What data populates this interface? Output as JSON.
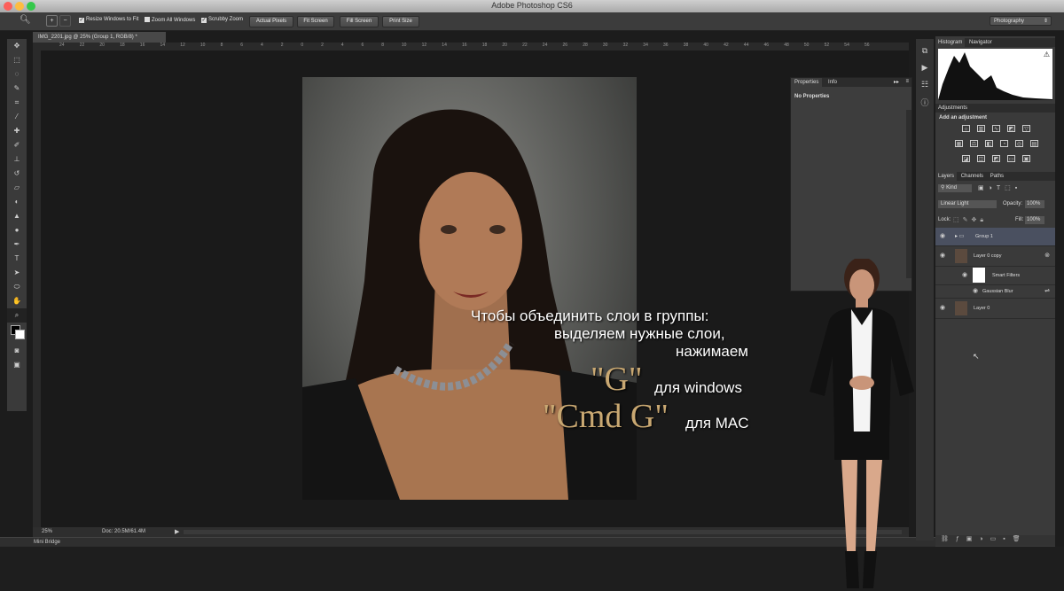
{
  "app": {
    "title": "Adobe Photoshop CS6"
  },
  "options_bar": {
    "checkboxes": [
      "Resize Windows to Fit",
      "Zoom All Windows",
      "Scrubby Zoom"
    ],
    "buttons": [
      "Actual Pixels",
      "Fit Screen",
      "Fill Screen",
      "Print Size"
    ],
    "workspace": "Photography"
  },
  "document": {
    "tab_title": "IMG_2201.jpg @ 25% (Group 1, RGB/8) *",
    "zoom": "25%",
    "doc_size": "Doc: 20.5M/61.4M",
    "ruler_ticks": [
      "24",
      "22",
      "20",
      "18",
      "16",
      "14",
      "12",
      "10",
      "8",
      "6",
      "4",
      "2",
      "0",
      "2",
      "4",
      "6",
      "8",
      "10",
      "12",
      "14",
      "16",
      "18",
      "20",
      "22",
      "24",
      "26",
      "28",
      "30",
      "32",
      "34",
      "36",
      "38",
      "40",
      "42",
      "44",
      "46",
      "48",
      "50",
      "52",
      "54",
      "56"
    ]
  },
  "mini_bridge": {
    "label": "Mini Bridge"
  },
  "properties_panel": {
    "tabs": [
      "Properties",
      "Info"
    ],
    "content": "No Properties"
  },
  "histogram_panel": {
    "tabs": [
      "Histogram",
      "Navigator"
    ]
  },
  "adjustments_panel": {
    "title": "Adjustments",
    "subtitle": "Add an adjustment"
  },
  "layers_panel": {
    "tabs": [
      "Layers",
      "Channels",
      "Paths"
    ],
    "kind": "Kind",
    "blend_mode": "Linear Light",
    "opacity_label": "Opacity:",
    "opacity": "100%",
    "lock_label": "Lock:",
    "fill_label": "Fill:",
    "fill": "100%",
    "layers": [
      {
        "name": "Group 1"
      },
      {
        "name": "Layer 0 copy"
      },
      {
        "name": "Smart Filters"
      },
      {
        "name": "Gaussian Blur"
      },
      {
        "name": "Layer 0"
      }
    ]
  },
  "overlay": {
    "line1": "Чтобы объединить слои в группы:",
    "line2": "выделяем нужные слои,",
    "line3": "нажимаем",
    "key_g": "\"G\"",
    "for_windows": "для windows",
    "key_cmdg": "\"Cmd G\"",
    "for_mac": "для MAC"
  },
  "colors": {
    "panel_bg": "#3a3a3a",
    "canvas_bg": "#1a1a1a",
    "selected_layer": "#4a5060",
    "gold_text": "#c9a872"
  }
}
